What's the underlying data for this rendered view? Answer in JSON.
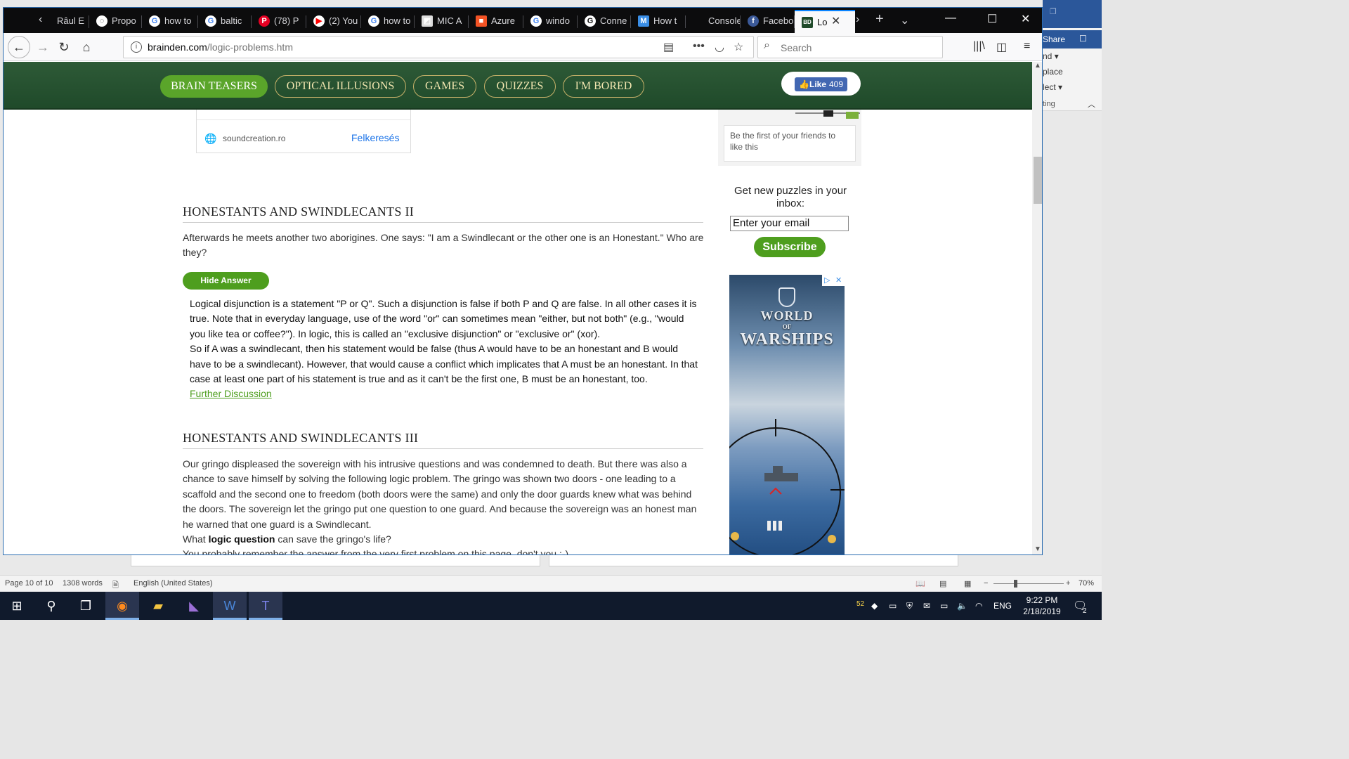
{
  "browser": {
    "tabs": [
      {
        "label": "Râul E",
        "icon": "tab-icon",
        "color": "#6e6e6e"
      },
      {
        "label": "Propo",
        "icon": "globe-icon",
        "color": "#222"
      },
      {
        "label": "how to",
        "icon": "google-icon",
        "color": "#4285f4"
      },
      {
        "label": "baltic",
        "icon": "google-icon",
        "color": "#4285f4"
      },
      {
        "label": "(78) P",
        "icon": "pinterest-icon",
        "color": "#e60023"
      },
      {
        "label": "(2) You",
        "icon": "youtube-icon",
        "color": "#ff0000"
      },
      {
        "label": "how to",
        "icon": "google-icon",
        "color": "#4285f4"
      },
      {
        "label": "MIC A",
        "icon": "mic-icon",
        "color": "#ddd"
      },
      {
        "label": "Azure",
        "icon": "microsoft-icon",
        "color": "#f35325"
      },
      {
        "label": "windo",
        "icon": "google-icon",
        "color": "#4285f4"
      },
      {
        "label": "Conne",
        "icon": "g-icon",
        "color": "#111"
      },
      {
        "label": "How t",
        "icon": "m-icon",
        "color": "#3a8ee6"
      },
      {
        "label": "Console A",
        "icon": "none",
        "color": "#000"
      },
      {
        "label": "Facebo",
        "icon": "facebook-icon",
        "color": "#3b5998"
      },
      {
        "label": "Lo",
        "icon": "bd-icon",
        "color": "#1f4a2a"
      }
    ],
    "address": {
      "domain": "brainden.com",
      "path": "/logic-problems.htm"
    },
    "search_placeholder": "Search"
  },
  "site": {
    "nav": [
      "BRAIN TEASERS",
      "OPTICAL ILLUSIONS",
      "GAMES",
      "QUIZZES",
      "I'M BORED"
    ],
    "fb_like": {
      "label": "Like",
      "count": "409"
    },
    "ad": {
      "domain": "soundcreation.ro",
      "visit": "Felkeresés"
    },
    "sidebar": {
      "fb_text": "Be the first of your friends to like this",
      "signup_title": "Get new puzzles in your inbox:",
      "email_value": "Enter your email",
      "subscribe": "Subscribe",
      "game_ad": {
        "line1": "WORLD",
        "line2": "OF",
        "line3": "WARSHIPS"
      }
    },
    "section2": {
      "title": "HONESTANTS AND SWINDLECANTS II",
      "question": "Afterwards he meets another two aborigines. One says: \"I am a Swindlecant or the other one is an Honestant.\" Who are they?",
      "hide_answer": "Hide Answer",
      "answer_p1": "Logical disjunction is a statement \"P or Q\". Such a disjunction is false if both P and Q are false. In all other cases it is true. Note that in everyday language, use of the word \"or\" can sometimes mean \"either, but not both\" (e.g., \"would you like tea or coffee?\"). In logic, this is called an \"exclusive disjunction\" or \"exclusive or\" (xor).",
      "answer_p2": "So if A was a swindlecant, then his statement would be false (thus A would have to be an honestant and B would have to be a swindlecant). However, that would cause a conflict which implicates that A must be an honestant. In that case at least one part of his statement is true and as it can't be the first one, B must be an honestant, too.",
      "further": "Further Discussion"
    },
    "section3": {
      "title": "HONESTANTS AND SWINDLECANTS III",
      "p1": "Our gringo displeased the sovereign with his intrusive questions and was condemned to death. But there was also a chance to save himself by solving the following logic problem. The gringo was shown two doors - one leading to a scaffold and the second one to freedom (both doors were the same) and only the door guards knew what was behind the doors. The sovereign let the gringo put one question to one guard. And because the sovereign was an honest man he warned that one guard is a Swindlecant.",
      "p2_pre": "What ",
      "p2_bold": "logic question",
      "p2_post": " can save the gringo's life?",
      "p3": "You probably remember the answer from the very first problem on this page, don't you :-)"
    }
  },
  "word": {
    "ribbon": {
      "share": "Share",
      "r1": "nd",
      "r2": "place",
      "r3": "lect",
      "r4": "ting"
    },
    "status": {
      "page": "Page 10 of 10",
      "words": "1308 words",
      "language": "English (United States)",
      "zoom": "70%"
    }
  },
  "taskbar": {
    "badge": "52",
    "lang": "ENG",
    "time": "9:22 PM",
    "date": "2/18/2019",
    "notif": "2"
  }
}
